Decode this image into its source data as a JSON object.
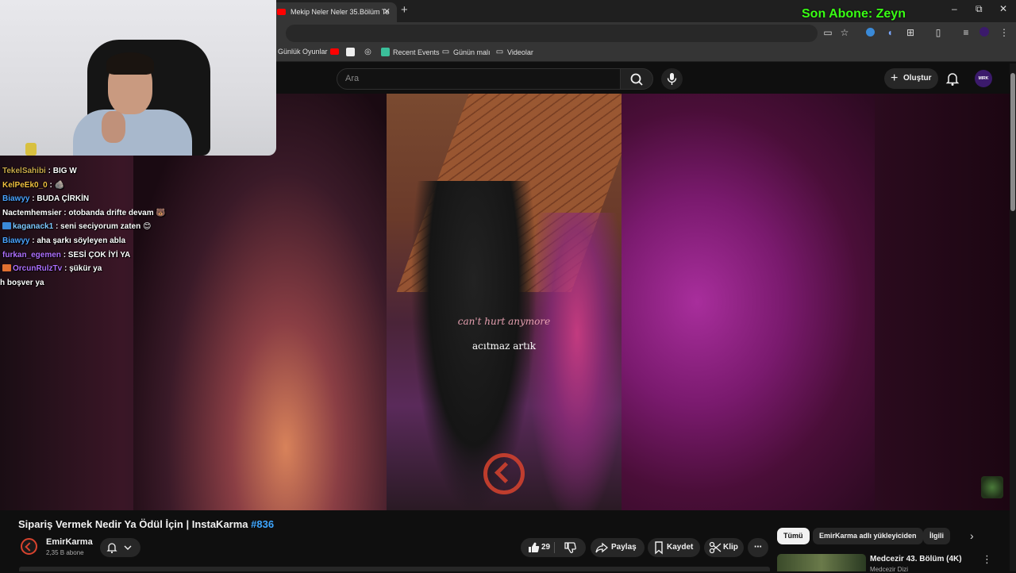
{
  "browser": {
    "tab_title": "Mekip Neler Neler 35.Bölüm Te",
    "tab_close": "✕",
    "new_tab": "+",
    "window_controls": [
      "–",
      "⧉",
      "✕"
    ],
    "bookmarks": [
      {
        "label": "Günlük Oyunlar",
        "icon": "folder-icon"
      },
      {
        "label": "",
        "icon": "youtube-icon"
      },
      {
        "label": "",
        "icon": "gamepad-icon"
      },
      {
        "label": "",
        "icon": "globe-icon"
      },
      {
        "label": "Recent Events",
        "icon": "bookmark-icon"
      },
      {
        "label": "Günün malı",
        "icon": "folder-icon"
      },
      {
        "label": "Videolar",
        "icon": "folder-icon"
      }
    ]
  },
  "overlay": {
    "sub_ticker": "Son Abone: Zeyn"
  },
  "youtube": {
    "search_placeholder": "Ara",
    "create_label": "Oluştur",
    "avatar_text": "MIRK",
    "video": {
      "lyric_en": "can't hurt anymore",
      "lyric_tr": "acıtmaz artık"
    },
    "title": "Sipariş Vermek Nedir Ya Ödül İçin | InstaKarma",
    "title_tag": "#836",
    "channel": {
      "name": "EmirKarma",
      "subs": "2,35 B abone"
    },
    "actions": {
      "likes": "29",
      "share": "Paylaş",
      "save": "Kaydet",
      "clip": "Klip",
      "more": "⋯"
    },
    "chips": [
      "Tümü",
      "EmirKarma adlı yükleyiciden",
      "İlgili"
    ],
    "recommendation": {
      "title": "Medcezir 43. Bölüm (4K)",
      "channel": "Medcezir Dizi"
    }
  },
  "chat": [
    {
      "user": "TekelSahibi",
      "message": ": BIG W",
      "color": "#c8a84a",
      "badge": ""
    },
    {
      "user": "KelPeEk0_0",
      "message": ": 🪨",
      "color": "#f0c040",
      "badge": ""
    },
    {
      "user": "Biawyy",
      "message": ": BUDA ÇİRKİN",
      "color": "#4aa3ff",
      "badge": ""
    },
    {
      "user": "Nactemhemsier",
      "message": ": otobanda drifte devam 🐻",
      "color": "#ffffff",
      "badge": ""
    },
    {
      "user": "kaganack1",
      "message": ": seni seciyorum zaten 😊",
      "color": "#7ec8ff",
      "badge": "#3a8ad8"
    },
    {
      "user": "Biawyy",
      "message": ": aha şarkı söyleyen abla",
      "color": "#4aa3ff",
      "badge": ""
    },
    {
      "user": "furkan_egemen",
      "message": ": SESİ ÇOK İYİ YA",
      "color": "#b070ff",
      "badge": ""
    },
    {
      "user": "OrcunRulzTv",
      "message": ": şükür ya",
      "color": "#b070ff",
      "badge": "#e07030"
    },
    {
      "user": "",
      "message": "h boşver ya",
      "color": "#ffffff",
      "badge": ""
    }
  ],
  "colors": {
    "ticker_green": "#39ff14",
    "brand_red": "#d8432e",
    "link_blue": "#3ea6ff"
  }
}
